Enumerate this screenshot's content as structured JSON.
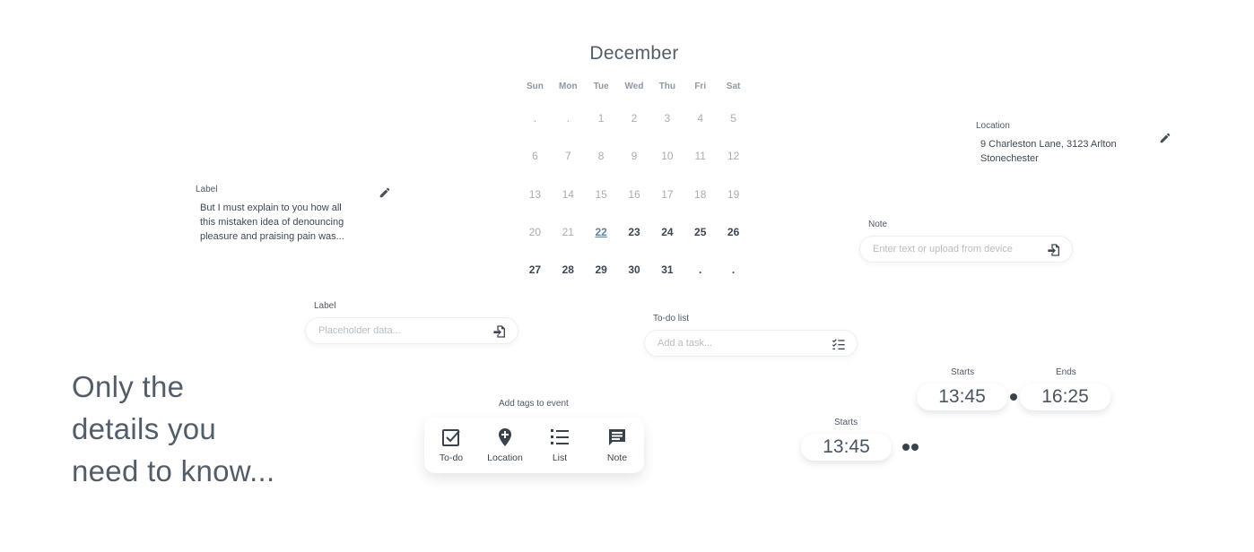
{
  "calendar": {
    "month": "December",
    "weekdays": [
      "Sun",
      "Mon",
      "Tue",
      "Wed",
      "Thu",
      "Fri",
      "Sat"
    ],
    "weeks": [
      [
        ".",
        ".",
        "1",
        "2",
        "3",
        "4",
        "5"
      ],
      [
        "6",
        "7",
        "8",
        "9",
        "10",
        "11",
        "12"
      ],
      [
        "13",
        "14",
        "15",
        "16",
        "17",
        "18",
        "19"
      ],
      [
        "20",
        "21",
        "22",
        "23",
        "24",
        "25",
        "26"
      ],
      [
        "27",
        "28",
        "29",
        "30",
        "31",
        ".",
        "."
      ]
    ],
    "today": "22"
  },
  "label_card": {
    "label": "Label",
    "text_lines": [
      "But I must explain to you how all",
      "this mistaken idea of denouncing",
      "pleasure and praising pain was..."
    ]
  },
  "location_card": {
    "label": "Location",
    "address_lines": [
      "9 Charleston Lane, 3123 Arlton",
      "Stonechester"
    ]
  },
  "note_field": {
    "label": "Note",
    "placeholder": "Enter text or upload from device"
  },
  "label_field": {
    "label": "Label",
    "placeholder": "Placeholder data..."
  },
  "todo_field": {
    "label": "To-do list",
    "placeholder": "Add a task..."
  },
  "tags": {
    "title": "Add tags to event",
    "items": [
      {
        "label": "To-do",
        "icon": "checkbox-icon"
      },
      {
        "label": "Location",
        "icon": "location-pin-icon"
      },
      {
        "label": "List",
        "icon": "numbered-list-icon"
      },
      {
        "label": "Note",
        "icon": "note-icon"
      }
    ]
  },
  "time_range": {
    "starts_label": "Starts",
    "starts_value": "13:45",
    "ends_label": "Ends",
    "ends_value": "16:25"
  },
  "time_single": {
    "starts_label": "Starts",
    "starts_value": "13:45"
  },
  "hero": {
    "lines": [
      "Only the",
      "details you",
      "need to know..."
    ]
  },
  "colors": {
    "text_dark": "#4a5563",
    "accent_today": "#5e80a3",
    "muted": "#a6adb5"
  }
}
